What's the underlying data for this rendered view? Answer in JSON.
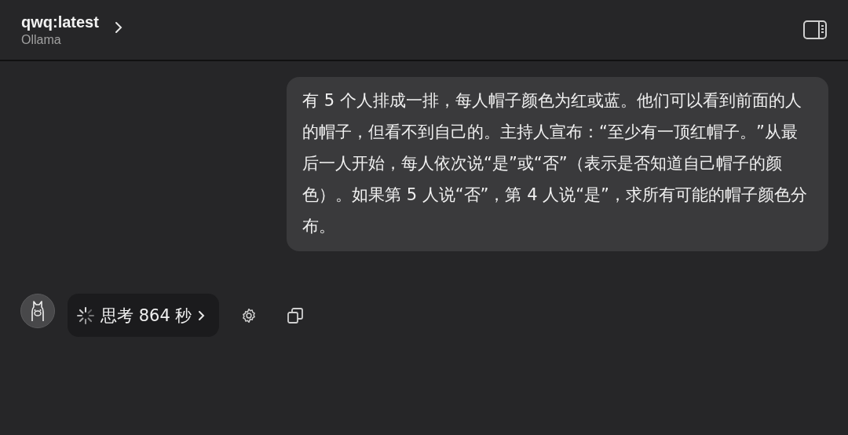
{
  "header": {
    "title": "qwq:latest",
    "subtitle": "Ollama"
  },
  "user_message": {
    "text": "有 5 个人排成一排，每人帽子颜色为红或蓝。他们可以看到前面的人的帽子，但看不到自己的。主持人宣布：“至少有一顶红帽子。”从最后一人开始，每人依次说“是”或“否”（表示是否知道自己帽子的颜色）。如果第 5 人说“否”，第 4 人说“是”，求所有可能的帽子颜色分布。"
  },
  "thinking": {
    "label": "思考 864 秒"
  }
}
